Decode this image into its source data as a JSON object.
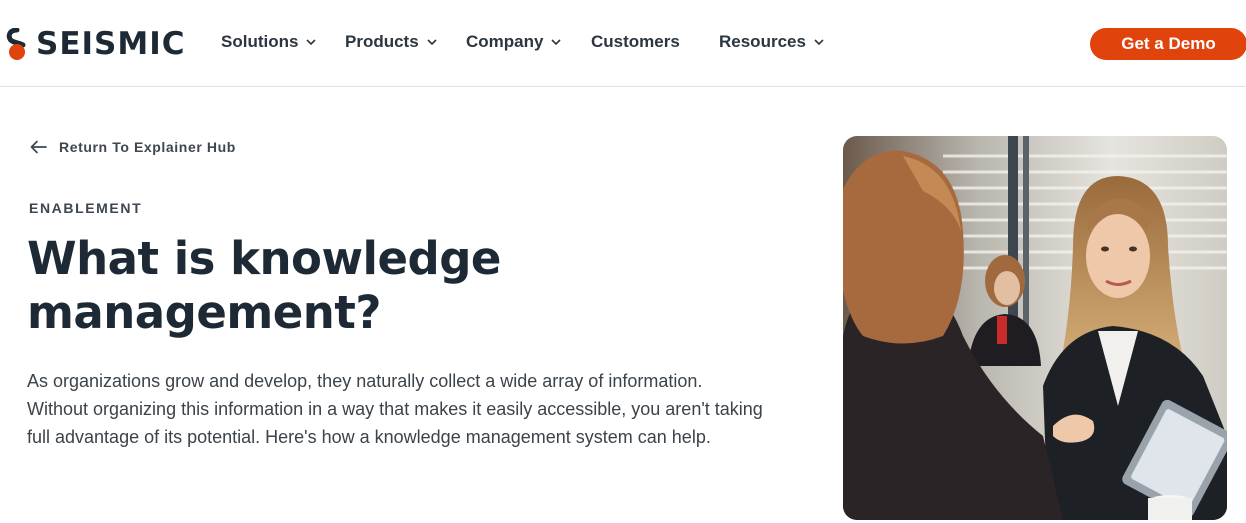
{
  "brand": {
    "name": "SEISMIC",
    "accent": "#e0430b",
    "dark": "#1d2a35"
  },
  "nav": {
    "items": [
      {
        "label": "Solutions",
        "has_dropdown": true
      },
      {
        "label": "Products",
        "has_dropdown": true
      },
      {
        "label": "Company",
        "has_dropdown": true
      },
      {
        "label": "Customers",
        "has_dropdown": false
      },
      {
        "label": "Resources",
        "has_dropdown": true
      }
    ],
    "cta_label": "Get a Demo"
  },
  "hero": {
    "back_link": "Return To Explainer Hub",
    "eyebrow": "ENABLEMENT",
    "title": "What is knowledge management?",
    "description": "As organizations grow and develop, they naturally collect a wide array of information. Without organizing this information in a way that makes it easily accessible, you aren't taking full advantage of its potential. Here's how a knowledge management system can help."
  },
  "icons": {
    "back": "arrow-left-icon",
    "dropdown": "chevron-down-icon"
  }
}
